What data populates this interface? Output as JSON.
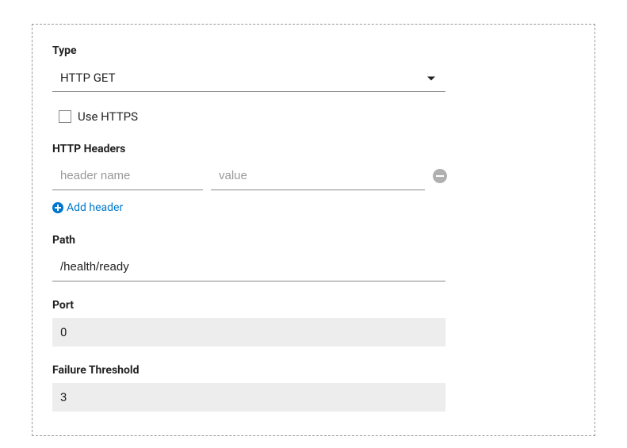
{
  "type": {
    "label": "Type",
    "value": "HTTP GET"
  },
  "useHttps": {
    "label": "Use HTTPS"
  },
  "httpHeaders": {
    "label": "HTTP Headers",
    "namePlaceholder": "header name",
    "valuePlaceholder": "value",
    "addLabel": "Add header"
  },
  "path": {
    "label": "Path",
    "value": "/health/ready"
  },
  "port": {
    "label": "Port",
    "value": "0"
  },
  "failureThreshold": {
    "label": "Failure Threshold",
    "value": "3"
  }
}
